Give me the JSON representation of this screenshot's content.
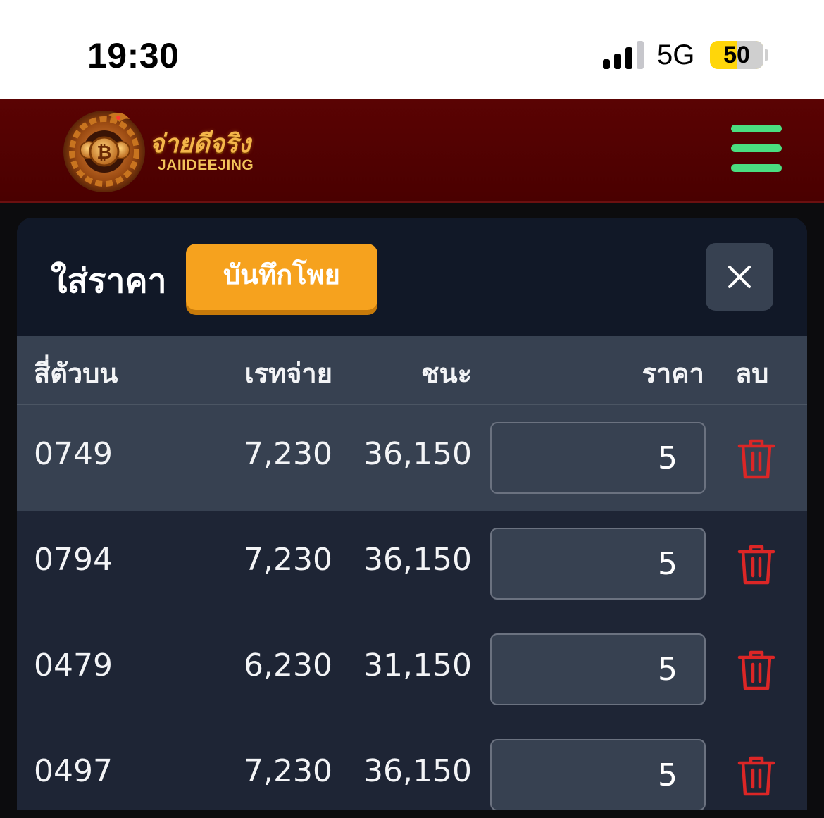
{
  "status_bar": {
    "time": "19:30",
    "network": "5G",
    "battery": "50",
    "battery_fraction": 0.5
  },
  "header": {
    "brand_thai": "จ่ายดีจริง",
    "brand_en": "JAIIDEEJING",
    "logo_coin_symbol": "₿",
    "menu_icon": "hamburger-icon",
    "colors": {
      "background": "#4a0000",
      "menu": "#4ade80",
      "brand": "#f4b64a"
    }
  },
  "panel": {
    "title": "ใส่ราคา",
    "save_label": "บันทึกโพย",
    "close_icon": "close-icon",
    "accent": "#f6a21e"
  },
  "table": {
    "columns": {
      "number": "สี่ตัวบน",
      "rate": "เรทจ่าย",
      "win": "ชนะ",
      "price": "ราคา",
      "delete": "ลบ"
    },
    "rows": [
      {
        "number": "0749",
        "rate": "7,230",
        "win": "36,150",
        "price": "5"
      },
      {
        "number": "0794",
        "rate": "7,230",
        "win": "36,150",
        "price": "5"
      },
      {
        "number": "0479",
        "rate": "6,230",
        "win": "31,150",
        "price": "5"
      },
      {
        "number": "0497",
        "rate": "7,230",
        "win": "36,150",
        "price": "5"
      }
    ],
    "delete_icon": "trash-icon",
    "delete_color": "#dc2626"
  }
}
